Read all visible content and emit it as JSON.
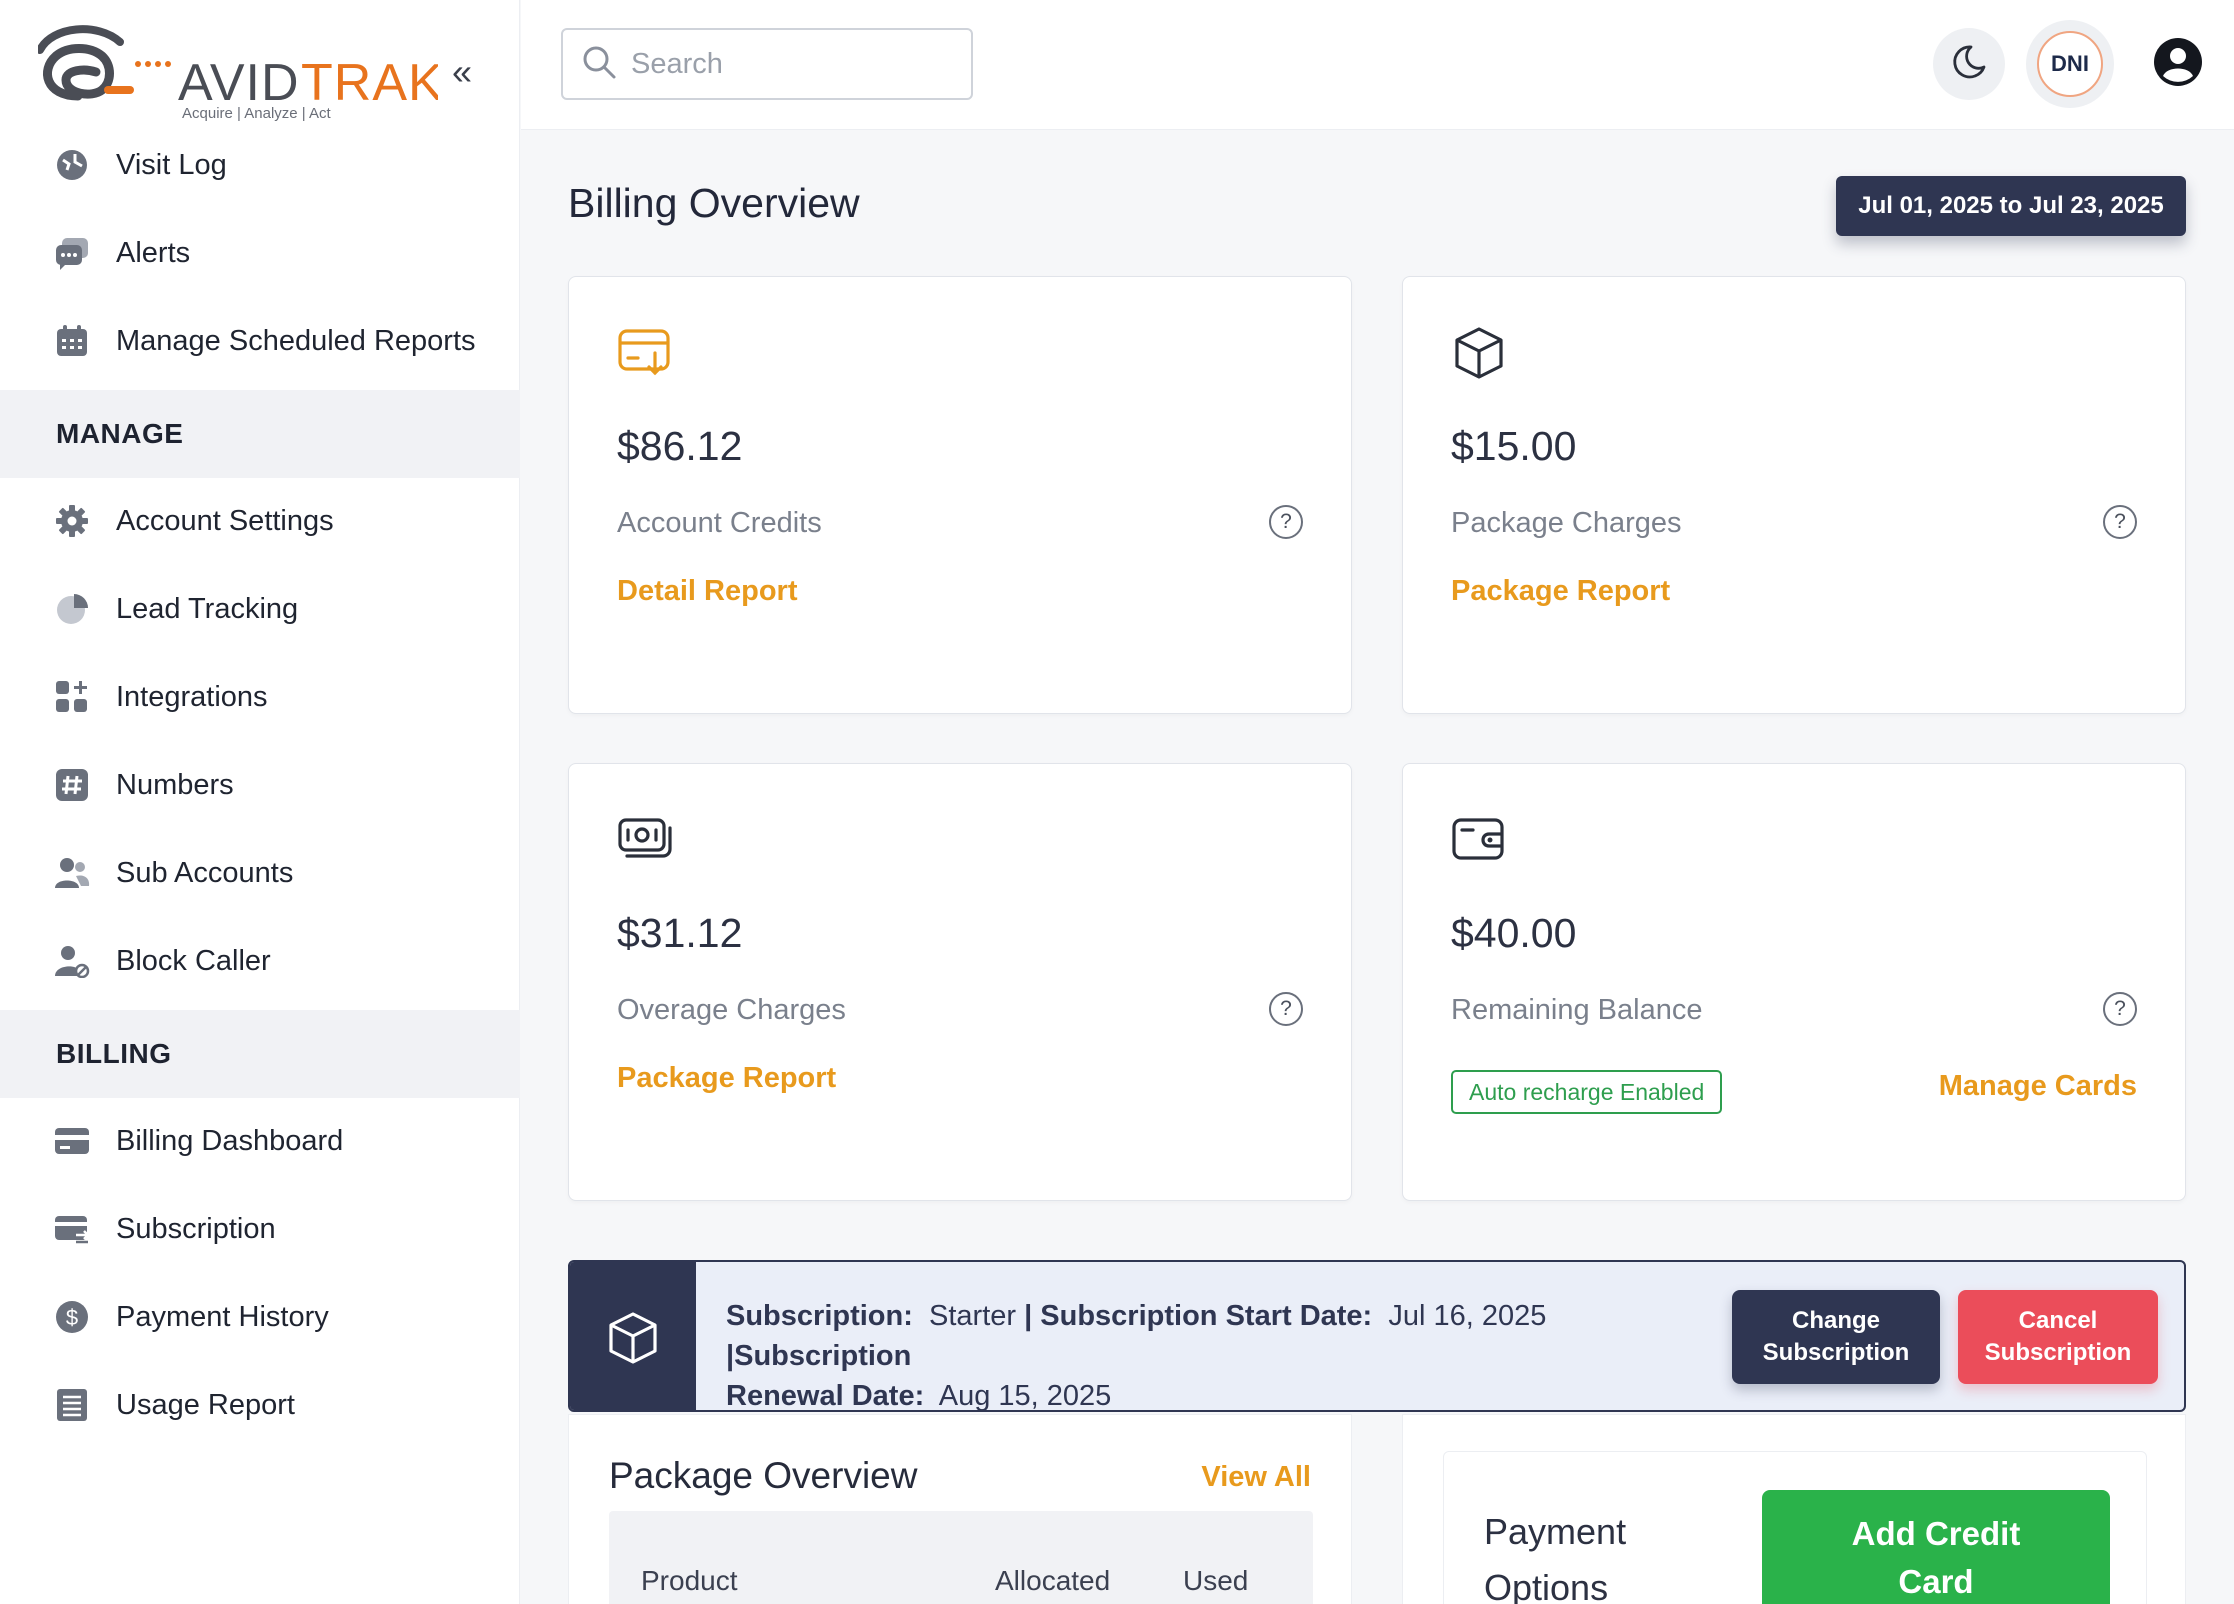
{
  "brand": {
    "name": "AVIDTRAK",
    "name_part1": "AVID",
    "name_part2": "TRAK",
    "tagline": "Acquire   |   Analyze   |   Act",
    "accent": "#E8731D"
  },
  "sidebar": {
    "top_items": [
      {
        "label": "Visit Log",
        "icon": "visit-log-icon"
      },
      {
        "label": "Alerts",
        "icon": "chat-alert-icon"
      },
      {
        "label": "Manage Scheduled Reports",
        "icon": "calendar-icon"
      }
    ],
    "manage": {
      "title": "MANAGE",
      "items": [
        {
          "label": "Account Settings",
          "icon": "gear-icon"
        },
        {
          "label": "Lead Tracking",
          "icon": "pie-chart-icon"
        },
        {
          "label": "Integrations",
          "icon": "apps-add-icon"
        },
        {
          "label": "Numbers",
          "icon": "hash-icon"
        },
        {
          "label": "Sub Accounts",
          "icon": "users-icon"
        },
        {
          "label": "Block Caller",
          "icon": "user-block-icon"
        }
      ]
    },
    "billing": {
      "title": "BILLING",
      "items": [
        {
          "label": "Billing Dashboard",
          "icon": "credit-card-icon"
        },
        {
          "label": "Subscription",
          "icon": "card-sync-icon"
        },
        {
          "label": "Payment History",
          "icon": "dollar-circle-icon"
        },
        {
          "label": "Usage Report",
          "icon": "report-list-icon"
        }
      ]
    }
  },
  "header": {
    "search_placeholder": "Search",
    "dni_label": "DNI"
  },
  "main": {
    "title": "Billing Overview",
    "date_range": "Jul 01, 2025 to Jul 23, 2025",
    "cards": [
      {
        "amount": "$86.12",
        "label": "Account Credits",
        "link": "Detail Report",
        "icon": "card-download-icon"
      },
      {
        "amount": "$15.00",
        "label": "Package Charges",
        "link": "Package Report",
        "icon": "box-icon"
      },
      {
        "amount": "$31.12",
        "label": "Overage Charges",
        "link": "Package Report",
        "icon": "money-icon"
      },
      {
        "amount": "$40.00",
        "label": "Remaining Balance",
        "badge": "Auto recharge Enabled",
        "link": "Manage Cards",
        "icon": "wallet-icon"
      }
    ],
    "subscription": {
      "label_sub": "Subscription:",
      "plan": "Starter",
      "label_start": "| Subscription Start Date:",
      "start_date": "Jul 16, 2025",
      "label_renew_1": "|Subscription",
      "label_renew_2": "Renewal Date:",
      "renewal_date": "Aug 15, 2025",
      "change_button": "Change Subscription",
      "cancel_button": "Cancel Subscription"
    },
    "package_overview": {
      "title": "Package Overview",
      "view_all": "View All",
      "columns": [
        "Product",
        "Allocated",
        "Used"
      ]
    },
    "payment_options": {
      "title": "Payment Options",
      "add_button": "Add Credit Card"
    }
  },
  "colors": {
    "primary_dark": "#2F3652",
    "accent_orange": "#E89A1D",
    "cancel_red": "#EB4D5A",
    "add_green": "#2AB24A",
    "badge_green": "#2E9E4E"
  }
}
